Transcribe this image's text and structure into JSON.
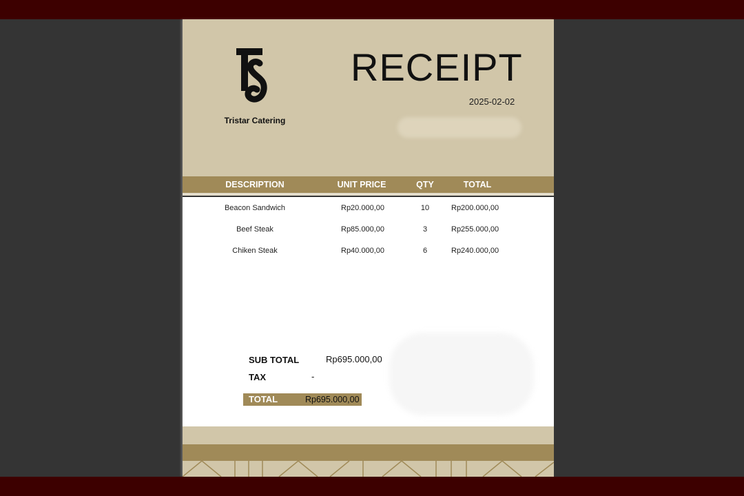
{
  "brand": {
    "name": "Tristar Catering",
    "logo": "TS"
  },
  "receipt": {
    "title": "RECEIPT",
    "date": "2025-02-02"
  },
  "table": {
    "headers": {
      "description": "DESCRIPTION",
      "unit_price": "UNIT PRICE",
      "qty": "QTY",
      "total": "TOTAL"
    },
    "rows": [
      {
        "description": "Beacon Sandwich",
        "unit_price": "Rp20.000,00",
        "qty": "10",
        "total": "Rp200.000,00"
      },
      {
        "description": "Beef Steak",
        "unit_price": "Rp85.000,00",
        "qty": "3",
        "total": "Rp255.000,00"
      },
      {
        "description": "Chiken Steak",
        "unit_price": "Rp40.000,00",
        "qty": "6",
        "total": "Rp240.000,00"
      }
    ]
  },
  "summary": {
    "subtotal_label": "SUB TOTAL",
    "subtotal_value": "Rp695.000,00",
    "tax_label": "TAX",
    "tax_value": "-",
    "total_label": "TOTAL",
    "total_value": "Rp695.000,00"
  },
  "colors": {
    "beige": "#d1c6a9",
    "gold": "#a08a58",
    "band": "#3d0000",
    "backdrop": "#343434"
  }
}
